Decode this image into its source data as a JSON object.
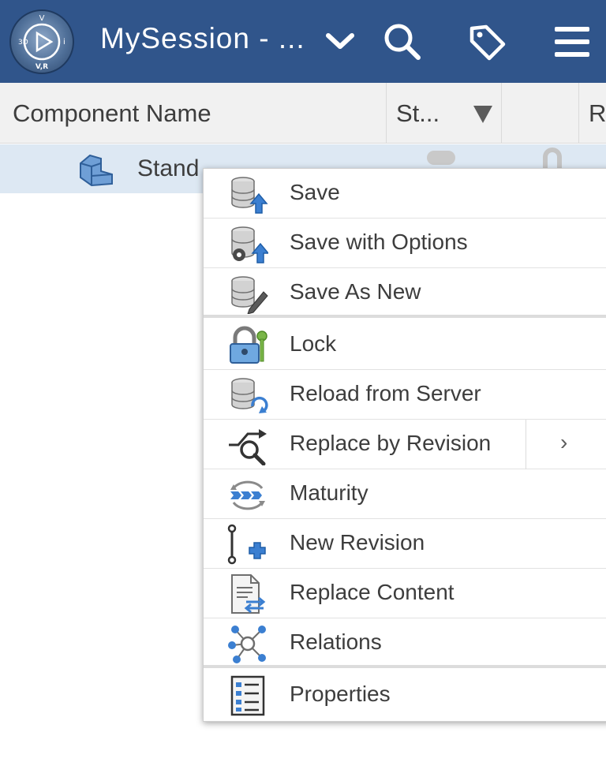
{
  "header": {
    "compass_top": "V",
    "compass_left": "3D",
    "compass_right": "i",
    "compass_bottom": "V,R",
    "title": "MySession - ...",
    "icons": [
      "chevron-down-icon",
      "search-icon",
      "tag-icon",
      "hamburger-menu-icon"
    ]
  },
  "columns": {
    "component_name": "Component Name",
    "status": "St...",
    "empty": "",
    "r": "R"
  },
  "row": {
    "icon": "part-icon",
    "label": "Stand"
  },
  "context_menu": {
    "items": [
      {
        "label": "Save",
        "icon": "save-icon"
      },
      {
        "label": "Save with Options",
        "icon": "save-options-icon"
      },
      {
        "label": "Save As New",
        "icon": "save-as-new-icon"
      },
      {
        "label": "Lock",
        "icon": "lock-icon"
      },
      {
        "label": "Reload from Server",
        "icon": "reload-icon"
      },
      {
        "label": "Replace by Revision",
        "icon": "replace-revision-icon",
        "submenu_arrow": "›"
      },
      {
        "label": "Maturity",
        "icon": "maturity-icon"
      },
      {
        "label": "New Revision",
        "icon": "new-revision-icon"
      },
      {
        "label": "Replace Content",
        "icon": "replace-content-icon"
      },
      {
        "label": "Relations",
        "icon": "relations-icon"
      },
      {
        "label": "Properties",
        "icon": "properties-icon"
      }
    ]
  },
  "colors": {
    "header_bg": "#30558b",
    "selected_row_bg": "#dde8f3",
    "db_icon": "#c8c8c8",
    "accent_blue": "#3b7fd1",
    "key_green": "#7ab648"
  }
}
